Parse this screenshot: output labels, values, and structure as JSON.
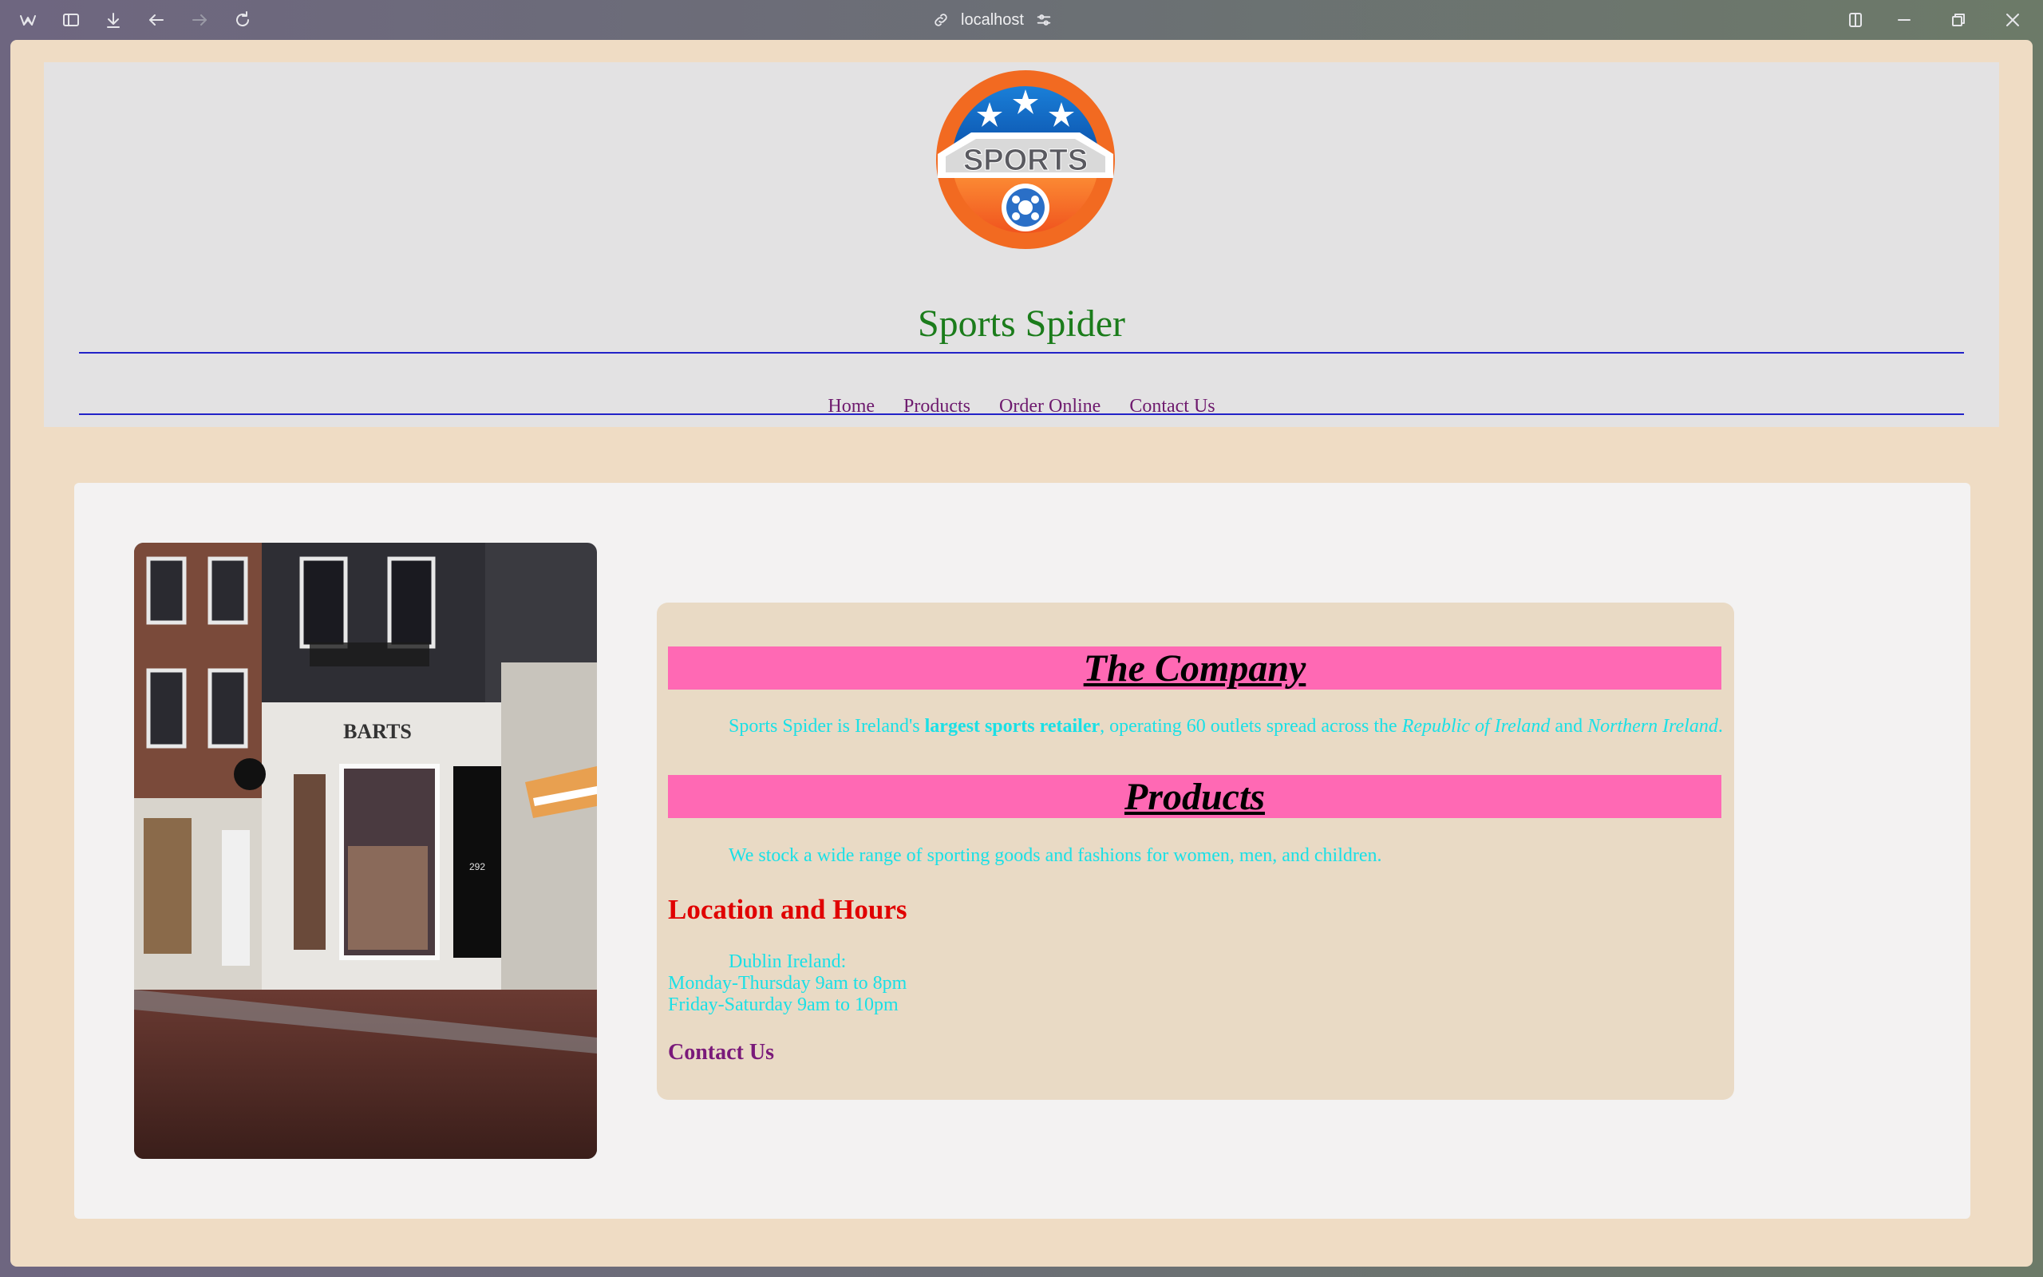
{
  "browser": {
    "address": "localhost"
  },
  "site": {
    "logo_text": "SPORTS",
    "title": "Sports Spider",
    "nav": [
      "Home",
      "Products",
      "Order Online",
      "Contact Us"
    ]
  },
  "photo": {
    "store_sign": "BARTS",
    "door_number": "292"
  },
  "company": {
    "heading": "The Company",
    "text_before": "Sports Spider is Ireland's ",
    "text_bold": "largest sports retailer",
    "text_middle": ", operating 60 outlets spread across the ",
    "region1": "Republic of Ireland",
    "text_and": " and ",
    "region2": "Northern Ireland",
    "text_end": "."
  },
  "products": {
    "heading": "Products",
    "text": "We stock a wide range of sporting goods and fashions for women, men, and children."
  },
  "location": {
    "heading": "Location and Hours",
    "lines": [
      "Dublin Ireland:",
      "Monday-Thursday 9am to 8pm",
      "Friday-Saturday 9am to 10pm"
    ]
  },
  "contact": {
    "heading": "Contact Us"
  },
  "colors": {
    "page_bg": "#efdcc4",
    "title_green": "#1b7c1b",
    "nav_purple": "#6e1a6e",
    "banner_pink": "#ff69b4",
    "body_cyan": "#1ae0e6",
    "heading_red": "#e00000"
  }
}
